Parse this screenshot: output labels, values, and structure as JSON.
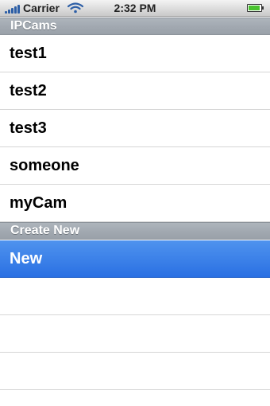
{
  "status_bar": {
    "carrier": "Carrier",
    "time": "2:32 PM",
    "icons": {
      "signal": "signal-icon",
      "wifi": "wifi-icon",
      "battery": "battery-icon"
    }
  },
  "sections": [
    {
      "header": "IPCams",
      "rows": [
        {
          "label": "test1"
        },
        {
          "label": "test2"
        },
        {
          "label": "test3"
        },
        {
          "label": "someone"
        },
        {
          "label": "myCam"
        }
      ]
    },
    {
      "header": "Create New",
      "rows": [
        {
          "label": "New",
          "selected": true
        }
      ]
    }
  ],
  "colors": {
    "selection": "#2a70e3",
    "section_header": "#a1a8b0",
    "battery_fill": "#49c22e"
  }
}
